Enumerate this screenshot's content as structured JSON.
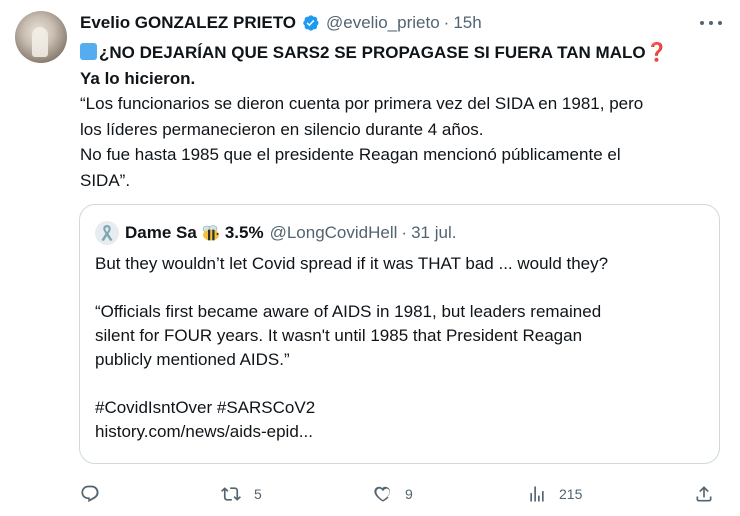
{
  "tweet": {
    "author_name": "Evelio GONZALEZ PRIETO",
    "handle": "@evelio_prieto",
    "separator": "·",
    "time": "15h",
    "lines": [
      "¿NO DEJARÍAN QUE SARS2 SE PROPAGASE SI FUERA TAN MALO",
      "Ya lo hicieron.",
      "“Los funcionarios se dieron cuenta por primera vez del SIDA en 1981, pero",
      "los líderes permanecieron en silencio durante 4 años.",
      "No fue hasta 1985 que el presidente Reagan mencionó públicamente el",
      "SIDA”."
    ],
    "question_mark": "❓"
  },
  "quote": {
    "author_name": "Dame Sa",
    "name_suffix": "3.5%",
    "handle": "@LongCovidHell",
    "separator": "·",
    "date": "31 jul.",
    "line1": "But they wouldn’t let Covid spread if it was THAT bad ... would they?",
    "para2": [
      "“Officials first became aware of AIDS in 1981, but leaders remained",
      "silent for FOUR years. It wasn't until 1985 that President Reagan",
      "publicly mentioned AIDS.”"
    ],
    "hashtags": "#CovidIsntOver #SARSCoV2",
    "link": "history.com/news/aids-epid..."
  },
  "actions": {
    "reply_count": "",
    "retweet_count": "5",
    "like_count": "9",
    "views_count": "215"
  },
  "icons": {
    "verified": "verified-badge-icon",
    "more": "more-options-icon",
    "reply": "reply-icon",
    "retweet": "retweet-icon",
    "like": "like-icon",
    "views": "views-icon",
    "share": "share-icon",
    "ribbon": "ribbon-icon",
    "bee": "bee-icon"
  },
  "colors": {
    "text": "#0f1419",
    "secondary": "#536471",
    "verified": "#1d9bf0",
    "border": "#cfd9de",
    "square_emoji": "#55acee",
    "question_emoji": "#dd2e44"
  }
}
